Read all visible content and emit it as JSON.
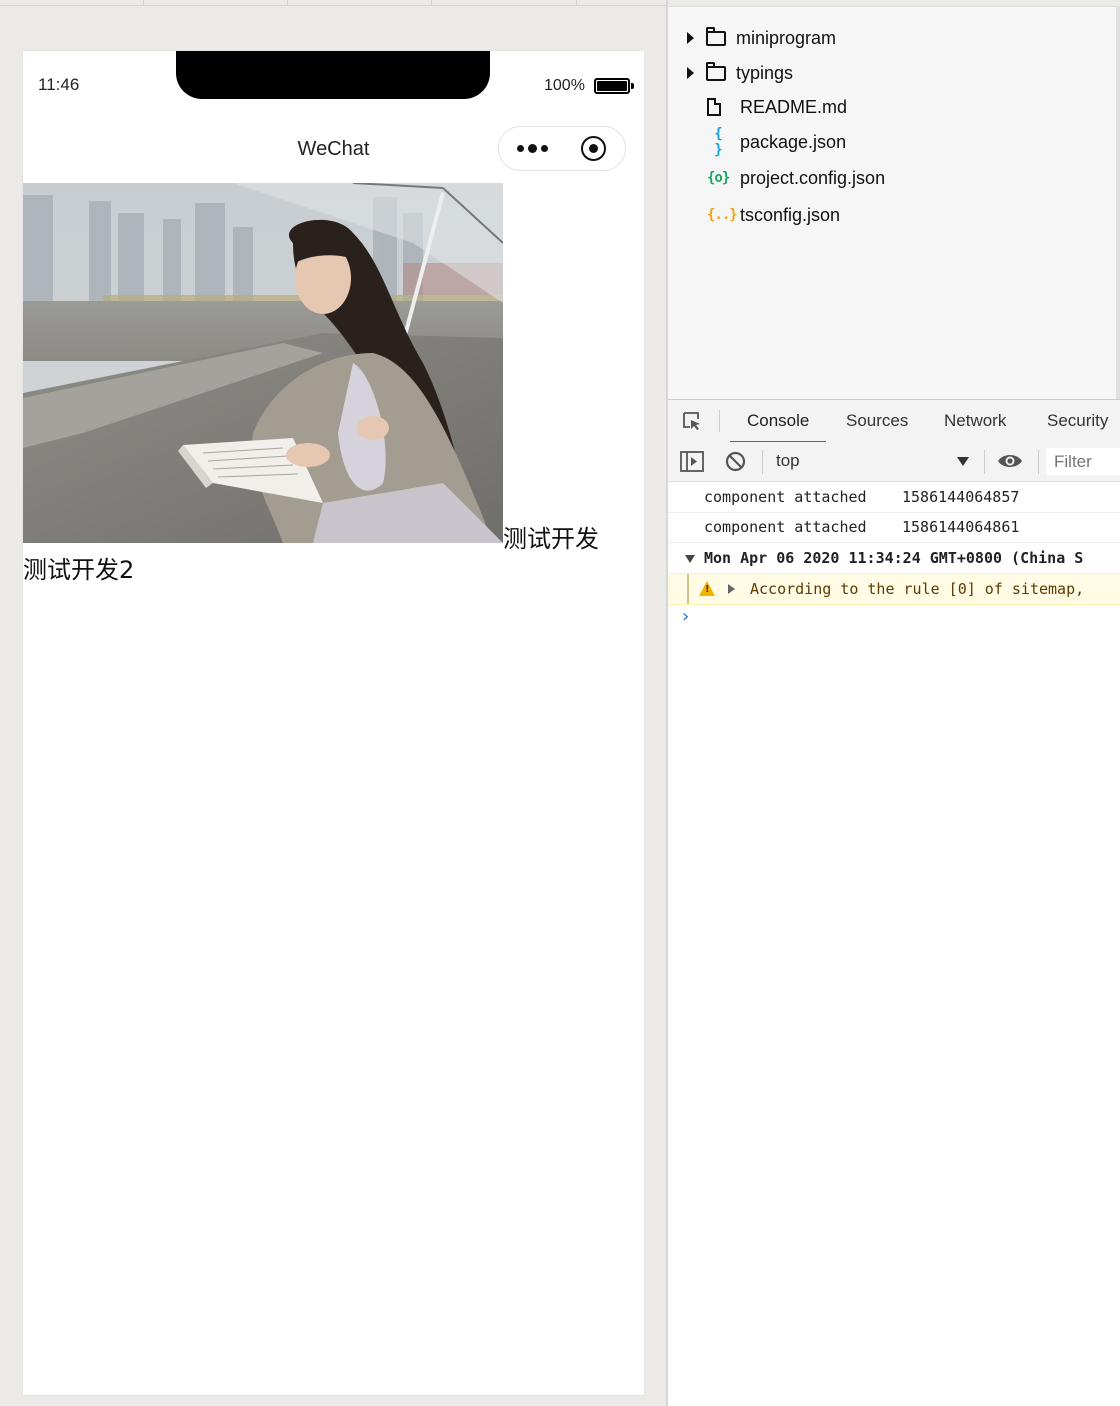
{
  "status_bar": {
    "time": "11:46",
    "battery_percent": "100%",
    "battery_level": 1.0
  },
  "navbar": {
    "title": "WeChat"
  },
  "page": {
    "text1": "测试开发",
    "text2": "测试开发2"
  },
  "file_tree": [
    {
      "name": "miniprogram",
      "kind": "folder",
      "icon": "folder-icon"
    },
    {
      "name": "typings",
      "kind": "folder",
      "icon": "folder-icon"
    },
    {
      "name": "README.md",
      "kind": "file",
      "icon": "file-icon"
    },
    {
      "name": "package.json",
      "kind": "json",
      "icon": "json-icon",
      "glyph": "{ }",
      "color": "#1aa3d6"
    },
    {
      "name": "project.config.json",
      "kind": "json",
      "icon": "config-json-icon",
      "glyph": "{o}",
      "color": "#15a865"
    },
    {
      "name": "tsconfig.json",
      "kind": "json",
      "icon": "ts-json-icon",
      "glyph": "{..}",
      "color": "#f0a30a"
    }
  ],
  "devtools": {
    "tabs": [
      "Console",
      "Sources",
      "Network",
      "Security"
    ],
    "active_tab": "Console",
    "context": "top",
    "filter_placeholder": "Filter"
  },
  "console": {
    "logs": [
      {
        "text": "component attached",
        "value": "1586144064857"
      },
      {
        "text": "component attached",
        "value": "1586144064861"
      }
    ],
    "group_header": "Mon Apr 06 2020 11:34:24 GMT+0800 (China S",
    "warning": "According to the rule [0] of sitemap,",
    "prompt": ">"
  },
  "colors": {
    "accent": "#1a73e8",
    "warning_bg": "#fffbe5",
    "warning_icon": "#f0b400"
  }
}
